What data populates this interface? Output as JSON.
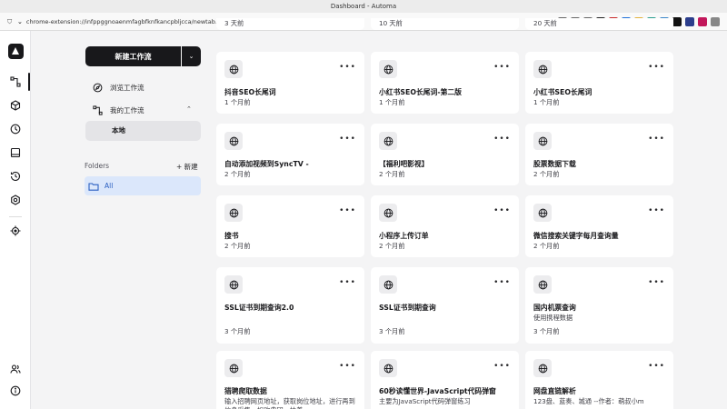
{
  "window": {
    "title": "Dashboard - Automa"
  },
  "urlbar": {
    "url": "chrome-extension://infppggnoaenmfagbfknfkancpbljcca/newtab.html#/workflows"
  },
  "extensions": [
    {
      "icon": "qr-icon",
      "color": "#666"
    },
    {
      "icon": "translate-icon",
      "color": "#666"
    },
    {
      "icon": "bookmark-icon",
      "color": "#666"
    },
    {
      "icon": "ext-dark-icon",
      "color": "#222"
    },
    {
      "icon": "ext-red-icon",
      "color": "#c62828"
    },
    {
      "icon": "ext-blue-icon",
      "color": "#1e6fd9"
    },
    {
      "icon": "ext-yellow-icon",
      "color": "#e3b23c"
    },
    {
      "icon": "ext-teal-icon",
      "color": "#2a9d8f"
    },
    {
      "icon": "ext-sun-icon",
      "color": "#3a86c8"
    },
    {
      "icon": "ext-black-icon",
      "color": "#111"
    },
    {
      "icon": "ext-navy-icon",
      "color": "#2c3e8c"
    },
    {
      "icon": "ext-pink-icon",
      "color": "#c2185b"
    },
    {
      "icon": "ext-grey-icon",
      "color": "#888"
    }
  ],
  "sidebar": {
    "new_workflow": "新建工作流",
    "browse": "浏览工作流",
    "my_workflows": "我的工作流",
    "local": "本地",
    "folders": "Folders",
    "new_folder": "+ 新建",
    "all": "All"
  },
  "top_row": [
    "3 天前",
    "10 天前",
    "20 天前"
  ],
  "cards": [
    {
      "name": "抖音SEO长尾词",
      "desc": "",
      "time": "1 个月前"
    },
    {
      "name": "小红书SEO长尾词-第二版",
      "desc": "",
      "time": "1 个月前"
    },
    {
      "name": "小红书SEO长尾词",
      "desc": "",
      "time": "1 个月前"
    },
    {
      "name": "自动添加视频到SyncTV -",
      "desc": "",
      "time": "2 个月前"
    },
    {
      "name": "【福利吧影视】",
      "desc": "",
      "time": "2 个月前"
    },
    {
      "name": "股票数据下载",
      "desc": "",
      "time": "2 个月前"
    },
    {
      "name": "搜书",
      "desc": "",
      "time": "2 个月前"
    },
    {
      "name": "小程序上传订单",
      "desc": "",
      "time": "2 个月前"
    },
    {
      "name": "微信搜索关键字每月查询量",
      "desc": "",
      "time": "2 个月前"
    },
    {
      "name": "SSL证书到期查询2.0",
      "desc": "",
      "time": "3 个月前"
    },
    {
      "name": "SSL证书到期查询",
      "desc": "",
      "time": "3 个月前"
    },
    {
      "name": "国内机票查询",
      "desc": "使用携程数据",
      "time": "3 个月前"
    },
    {
      "name": "猎聘爬取数据",
      "desc": "输入招聘网页地址，获取岗位地址，进行再到信息采集，扣攻典团，拮着",
      "time": ""
    },
    {
      "name": "60秒读懂世界-JavaScript代码弹窗",
      "desc": "主要为JavaScript代码弹窗练习",
      "time": ""
    },
    {
      "name": "网盘直链解析",
      "desc": "123盘、蓝奏、城通 --作者：萌叔小m",
      "time": ""
    }
  ]
}
